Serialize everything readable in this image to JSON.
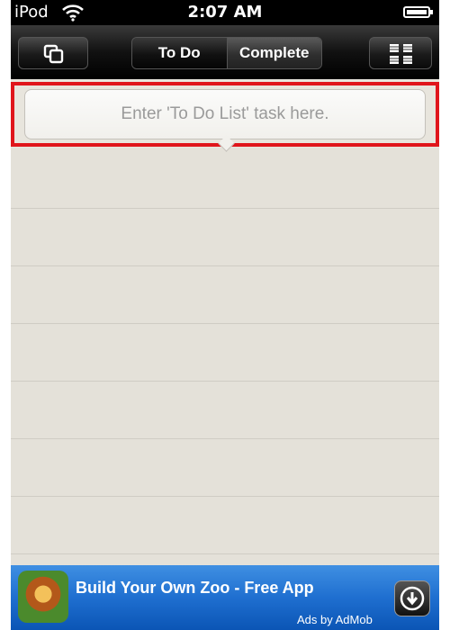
{
  "status_bar": {
    "carrier": "iPod",
    "time": "2:07 AM"
  },
  "toolbar": {
    "left_icon": "copy-icon",
    "right_icon": "grid-icon",
    "segments": [
      {
        "label": "To Do",
        "active": false
      },
      {
        "label": "Complete",
        "active": true
      }
    ]
  },
  "task_input": {
    "placeholder": "Enter 'To Do List' task here.",
    "value": ""
  },
  "ad": {
    "title": "Build Your Own Zoo - Free App",
    "credit": "Ads by AdMob",
    "icon": "lion-icon",
    "action_icon": "download-icon"
  },
  "colors": {
    "highlight": "#e0151b",
    "ad_blue": "#1f6fd0",
    "paper": "#e4e1d9"
  }
}
